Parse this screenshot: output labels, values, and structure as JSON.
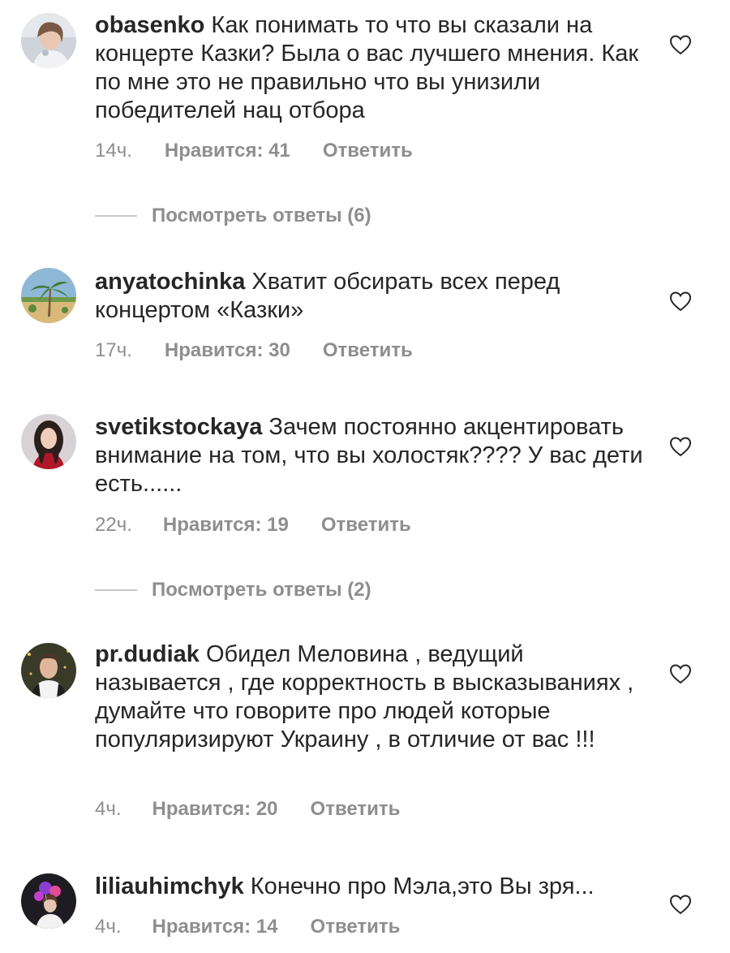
{
  "comments": [
    {
      "username": "obasenko",
      "text": " Как понимать то что вы сказали на концерте Казки? Была о вас лучшего мнения.  Как по мне это не правильно что вы унизили  победителей  нац отбора",
      "time": "14ч.",
      "likes": "Нравится: 41",
      "reply": "Ответить",
      "avatar_icon": "profile-photo-woman",
      "view_replies": "Посмотреть ответы (6)"
    },
    {
      "username": "anyatochinka",
      "text": " Хватит обсирать всех перед концертом «Казки»",
      "time": "17ч.",
      "likes": "Нравится: 30",
      "reply": "Ответить",
      "avatar_icon": "profile-photo-palm-tree"
    },
    {
      "username": "svetikstockaya",
      "text": " Зачем постоянно акцентировать внимание на том, что вы холостяк???? У вас дети есть......",
      "time": "22ч.",
      "likes": "Нравится: 19",
      "reply": "Ответить",
      "avatar_icon": "profile-photo-woman-dark-hair",
      "view_replies": "Посмотреть ответы (2)"
    },
    {
      "username": "pr.dudiak",
      "text": " Обидел Меловина , ведущий называется , где корректность в высказываниях , думайте что говорите про людей которые популяризируют Украину , в отличие от вас !!!",
      "time": "4ч.",
      "likes": "Нравится: 20",
      "reply": "Ответить",
      "avatar_icon": "profile-photo-man"
    },
    {
      "username": "liliauhimchyk",
      "text": " Конечно про Мэла,это Вы зря...",
      "time": "4ч.",
      "likes": "Нравится: 14",
      "reply": "Ответить",
      "avatar_icon": "profile-photo-balloons"
    }
  ],
  "colors": {
    "text": "#262626",
    "secondary": "#8e8e8e",
    "divider": "#c7c7c7",
    "background": "#ffffff"
  },
  "icons": {
    "like": "heart-outline-icon"
  }
}
